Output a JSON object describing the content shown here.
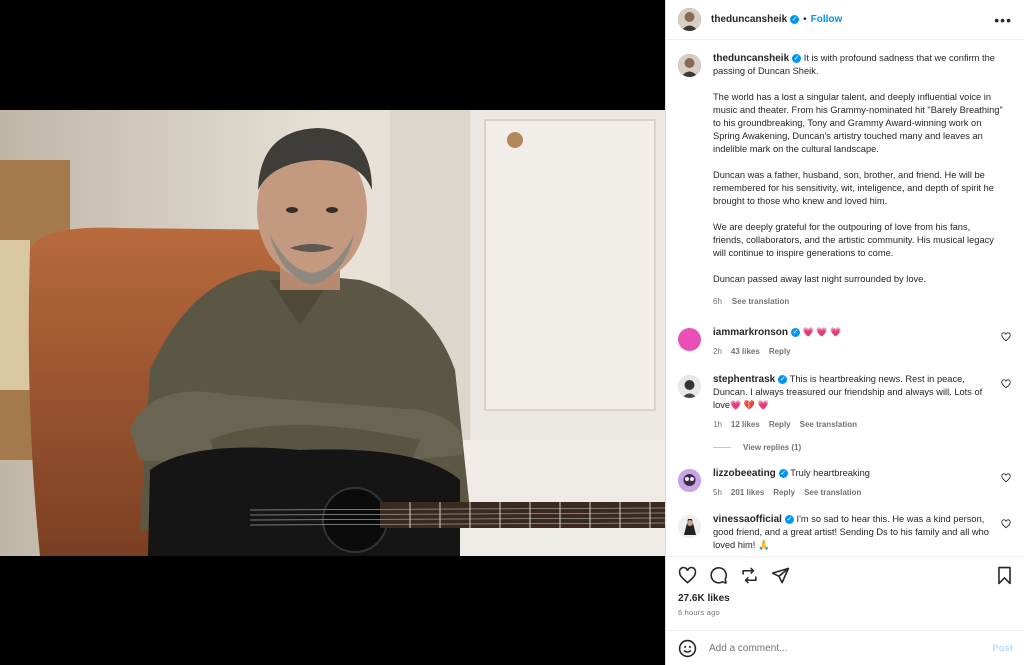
{
  "post": {
    "author": "theduncansheik",
    "follow_label": "Follow",
    "dot": "•",
    "more_label": "•••"
  },
  "caption": {
    "author": "theduncansheik",
    "p1": "It is with profound sadness that we confirm the passing of Duncan Sheik.",
    "p2": "The world has a lost a singular talent, and deeply influential voice in music and theater. From his Grammy-nominated hit \"Barely Breathing\" to his groundbreaking, Tony and Grammy Award-winning work on Spring Awakening, Duncan's artistry touched many and leaves an indelible mark on the cultural landscape.",
    "p3": "Duncan was a father, husband, son, brother, and friend. He will be remembered for his sensitivity, wit, inteligence, and depth of spirit he brought to those who knew and loved him.",
    "p4": "We are deeply grateful for the outpouring of love from his fans, friends, collaborators, and the artistic community. His musical legacy will continue to inspire generations to come.",
    "p5": "Duncan passed away last night surrounded by love.",
    "age": "6h",
    "see_translation": "See translation"
  },
  "comments": [
    {
      "user": "iammarkronson",
      "text": "",
      "hearts": "💗 💗 💗",
      "age": "2h",
      "likes": "43 likes",
      "reply": "Reply",
      "translate": "",
      "avatar_color": "#e94fb5"
    },
    {
      "user": "stephentrask",
      "text": "This is heartbreaking news. Rest in peace, Duncan. I always treasured our friendship and always will. Lots of love",
      "hearts": "💗 💔 💗",
      "age": "1h",
      "likes": "12 likes",
      "reply": "Reply",
      "translate": "See translation",
      "avatar_color": "#cfcfcf"
    },
    {
      "user": "lizzobeeating",
      "text": "Truly heartbreaking",
      "hearts": "",
      "age": "5h",
      "likes": "201 likes",
      "reply": "Reply",
      "translate": "See translation",
      "avatar_color": "#b28ad8"
    },
    {
      "user": "vinessaofficial",
      "text": "I'm so sad to hear this. He was a kind person, good friend, and a great artist! Sending Ds to his family and all who loved him! 🙏",
      "hearts": "",
      "age": "",
      "likes": "",
      "reply": "",
      "translate": "",
      "avatar_color": "#d9d9d9"
    }
  ],
  "view_replies": "View replies (1)",
  "stats": {
    "likes": "27.6K likes",
    "time": "6 hours ago"
  },
  "add_comment": {
    "placeholder": "Add a comment...",
    "post_label": "Post"
  },
  "icons": [
    "heart-icon",
    "comment-icon",
    "share-icon",
    "send-icon",
    "bookmark-icon",
    "emoji-icon",
    "more-icon"
  ]
}
